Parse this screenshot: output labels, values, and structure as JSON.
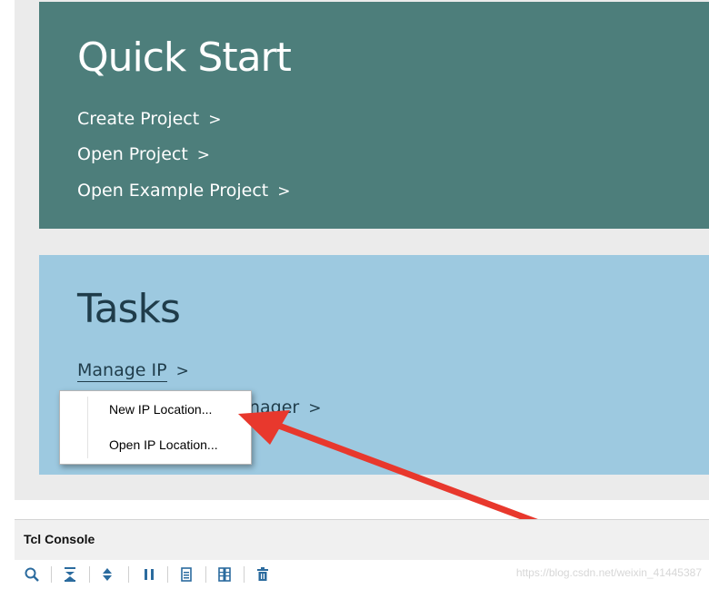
{
  "quick_start": {
    "title": "Quick Start",
    "links": [
      "Create Project",
      "Open Project",
      "Open Example Project"
    ]
  },
  "tasks": {
    "title": "Tasks",
    "manage_ip": "Manage IP",
    "hidden_link_fragment": "nager"
  },
  "chevron": ">",
  "context_menu": {
    "items": [
      "New IP Location...",
      "Open IP Location..."
    ]
  },
  "tcl_console": {
    "title": "Tcl Console",
    "toolbar_icons": [
      "search-icon",
      "collapse-all-icon",
      "expand-all-icon",
      "pause-icon",
      "clear-page-icon",
      "column-view-icon",
      "delete-icon"
    ]
  },
  "watermark": "https://blog.csdn.net/weixin_41445387",
  "colors": {
    "quick_start_bg": "#4d7e7b",
    "tasks_bg": "#9dc9e0",
    "arrow": "#e8382d",
    "icon": "#2b6b9e"
  }
}
